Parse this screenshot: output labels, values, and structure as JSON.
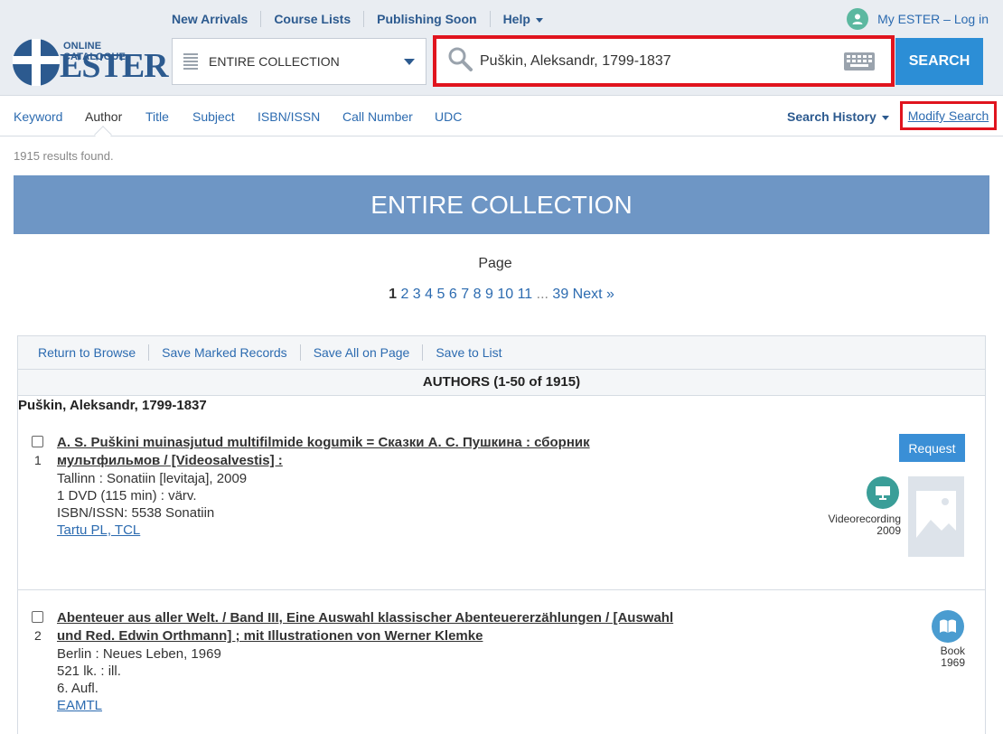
{
  "header": {
    "nav": [
      {
        "label": "New Arrivals"
      },
      {
        "label": "Course Lists"
      },
      {
        "label": "Publishing Soon"
      },
      {
        "label": "Help"
      }
    ],
    "login_label": "My ESTER – Log in",
    "logo_small": "ONLINE CATALOGUE",
    "logo_big": "ESTER",
    "scope_label": "ENTIRE COLLECTION",
    "search_value": "Puškin, Aleksandr, 1799-1837",
    "search_button": "SEARCH"
  },
  "tabs": [
    {
      "label": "Keyword"
    },
    {
      "label": "Author"
    },
    {
      "label": "Title"
    },
    {
      "label": "Subject"
    },
    {
      "label": "ISBN/ISSN"
    },
    {
      "label": "Call Number"
    },
    {
      "label": "UDC"
    }
  ],
  "search_history_label": "Search History",
  "modify_search_label": "Modify Search",
  "results_count": "1915 results found.",
  "banner": "ENTIRE COLLECTION",
  "pager": {
    "title": "Page",
    "current": "1",
    "pages": [
      "2",
      "3",
      "4",
      "5",
      "6",
      "7",
      "8",
      "9",
      "10",
      "11"
    ],
    "ellipsis": "...",
    "last": "39",
    "next": "Next »"
  },
  "toolbar": {
    "return": "Return to Browse",
    "save_marked": "Save Marked Records",
    "save_all": "Save All on Page",
    "save_list": "Save to List"
  },
  "authors_heading": "AUTHORS (1-50 of 1915)",
  "author_name": "Puškin, Aleksandr, 1799-1837",
  "records": [
    {
      "num": "1",
      "title": "A. S. Puškini muinasjutud multifilmide kogumik = Сказки А. С. Пушкина : сборник мультфильмов / [Videosalvestis] :",
      "lines": [
        "Tallinn : Sonatiin [levitaja], 2009",
        "1 DVD (115 min) : värv.",
        "ISBN/ISSN:  5538 Sonatiin"
      ],
      "location": "Tartu PL, TCL",
      "request": "Request",
      "type": "Videorecording",
      "year": "2009"
    },
    {
      "num": "2",
      "title": "Abenteuer aus aller Welt. / Band III, Eine Auswahl klassischer Abenteuererzählungen / [Auswahl und Red. Edwin Orthmann] ; mit Illustrationen von Werner Klemke",
      "lines": [
        "Berlin : Neues Leben, 1969",
        "521 lk. : ill.",
        "6. Aufl."
      ],
      "location": "EAMTL",
      "type": "Book",
      "year": "1969"
    }
  ],
  "colors": {
    "accent": "#2c8ed6",
    "highlight": "#e0141e",
    "banner": "#6e96c5",
    "icon": "#5cb8a0"
  }
}
